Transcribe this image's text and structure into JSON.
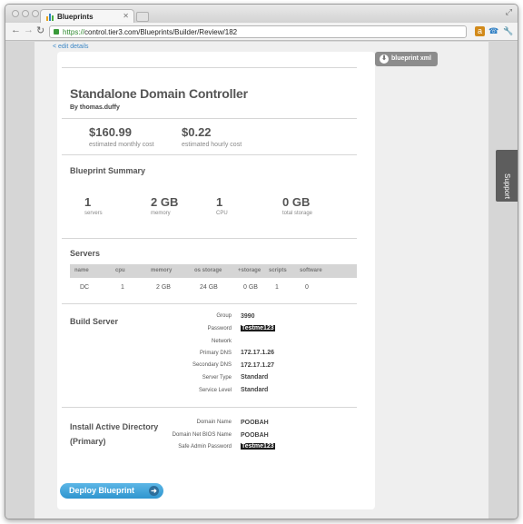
{
  "browser": {
    "tab_title": "Blueprints",
    "url_scheme": "https://",
    "url_rest": "control.tier3.com/Blueprints/Builder/Review/182"
  },
  "nav": {
    "edit_link": "< edit details",
    "xml_button": "blueprint xml",
    "support_tab": "Support"
  },
  "header": {
    "title": "Standalone Domain Controller",
    "byline": "By thomas.duffy"
  },
  "costs": {
    "monthly_value": "$160.99",
    "monthly_label": "estimated monthly cost",
    "hourly_value": "$0.22",
    "hourly_label": "estimated hourly cost"
  },
  "summary": {
    "title": "Blueprint Summary",
    "items": [
      {
        "value": "1",
        "label": "servers"
      },
      {
        "value": "2 GB",
        "label": "memory"
      },
      {
        "value": "1",
        "label": "CPU"
      },
      {
        "value": "0 GB",
        "label": "total storage"
      }
    ]
  },
  "servers": {
    "title": "Servers",
    "columns": [
      "name",
      "cpu",
      "memory",
      "os storage",
      "+storage",
      "scripts",
      "software"
    ],
    "rows": [
      [
        "DC",
        "1",
        "2 GB",
        "24 GB",
        "0 GB",
        "1",
        "0"
      ]
    ]
  },
  "build_server": {
    "title": "Build Server",
    "fields": [
      {
        "key": "Group",
        "value": "3990",
        "masked": false
      },
      {
        "key": "Password",
        "value": "Testme123",
        "masked": true
      },
      {
        "key": "Network",
        "value": "",
        "masked": false
      },
      {
        "key": "Primary DNS",
        "value": "172.17.1.26",
        "masked": false
      },
      {
        "key": "Secondary DNS",
        "value": "172.17.1.27",
        "masked": false
      },
      {
        "key": "Server Type",
        "value": "Standard",
        "masked": false
      },
      {
        "key": "Service Level",
        "value": "Standard",
        "masked": false
      }
    ]
  },
  "active_directory": {
    "title_line1": "Install Active Directory",
    "title_line2": "(Primary)",
    "fields": [
      {
        "key": "Domain Name",
        "value": "POOBAH",
        "masked": false
      },
      {
        "key": "Domain Net BIOS Name",
        "value": "POOBAH",
        "masked": false
      },
      {
        "key": "Safe Admin Password",
        "value": "Testme123",
        "masked": true
      }
    ]
  },
  "footer": {
    "deploy_button": "Deploy Blueprint"
  },
  "colors": {
    "link": "#3b86c5",
    "deploy_button": "#3fa5dc",
    "masked_bg": "#1b1b1b"
  }
}
